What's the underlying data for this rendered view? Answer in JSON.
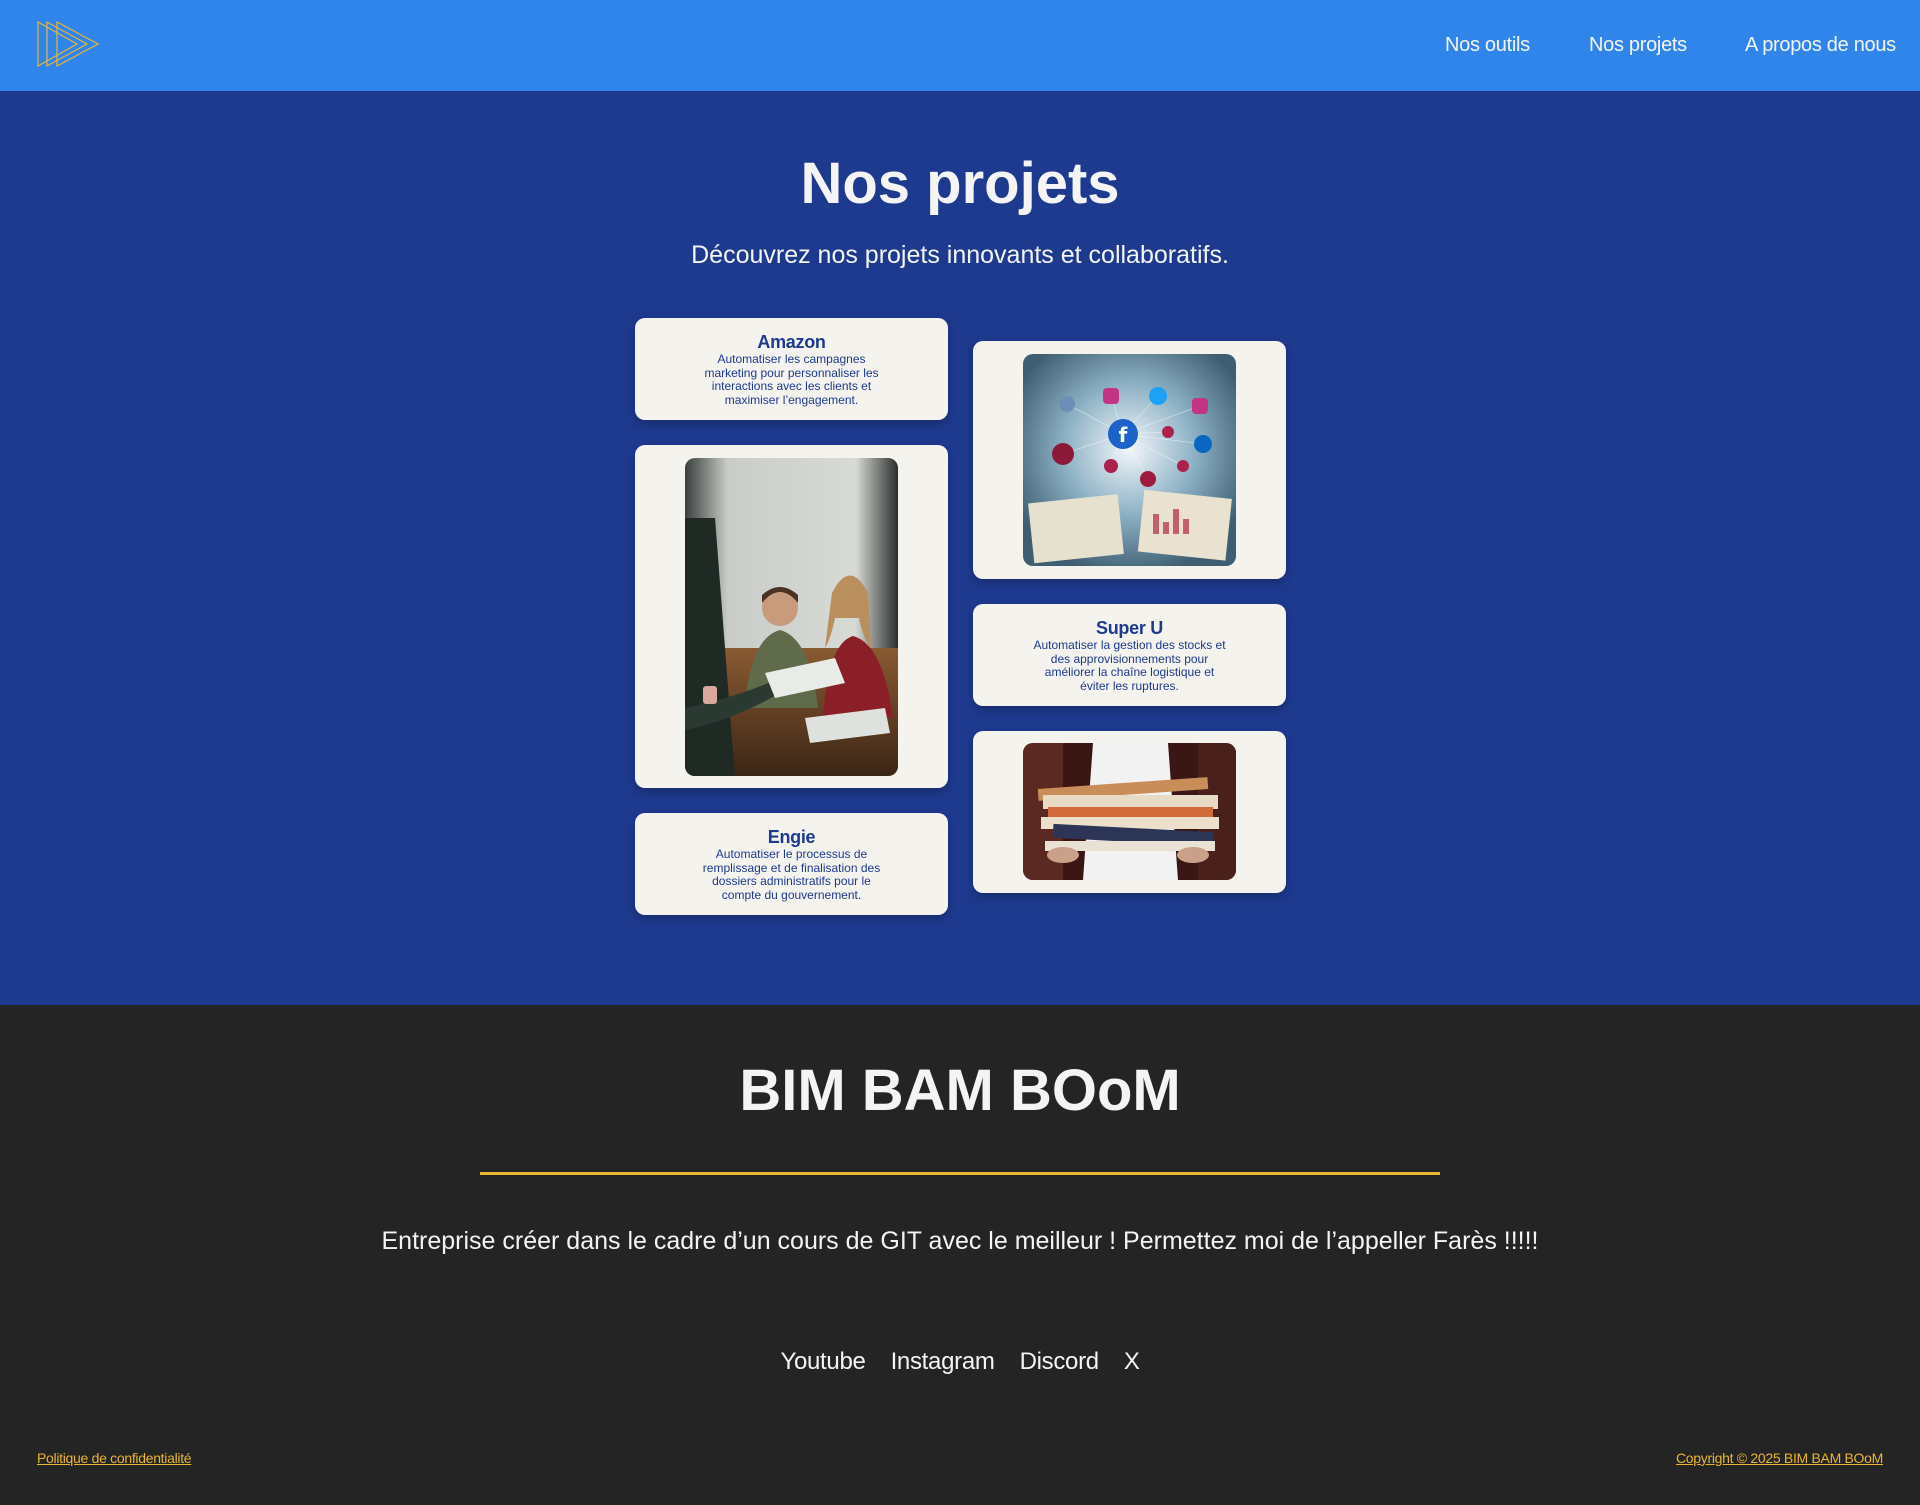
{
  "header": {
    "nav": [
      {
        "label": "Nos outils"
      },
      {
        "label": "Nos projets"
      },
      {
        "label": "A propos de nous"
      }
    ]
  },
  "main": {
    "title": "Nos projets",
    "subtitle": "Découvrez nos projets innovants et collaboratifs.",
    "projects": [
      {
        "name": "Amazon",
        "description": "Automatiser les campagnes marketing pour personnaliser les interactions avec les clients et maximiser l’engagement."
      },
      {
        "name": "Engie",
        "description": "Automatiser le processus de remplissage et de finalisation des dossiers administratifs pour le compte du gouvernement."
      },
      {
        "name": "Super U",
        "description": "Automatiser la gestion des stocks et des approvisionnements pour améliorer la chaîne logistique et éviter les ruptures."
      }
    ]
  },
  "footer": {
    "brand": "BIM BAM BOoM",
    "tagline": "Entreprise créer dans le cadre d’un cours de GIT avec le meilleur ! Permettez moi de l’appeller Farès !!!!!",
    "socials": [
      {
        "label": "Youtube"
      },
      {
        "label": "Instagram"
      },
      {
        "label": "Discord"
      },
      {
        "label": "X"
      }
    ],
    "privacy": "Politique de confidentialité",
    "copyright": "Copyright © 2025 BIM BAM BOoM"
  },
  "colors": {
    "header_bg": "#2f85ea",
    "main_bg": "#1e3a8f",
    "footer_bg": "#242424",
    "accent": "#e9b533",
    "card_bg": "#f4f3ee"
  },
  "icons": {
    "logo": "triple-play-icon"
  }
}
